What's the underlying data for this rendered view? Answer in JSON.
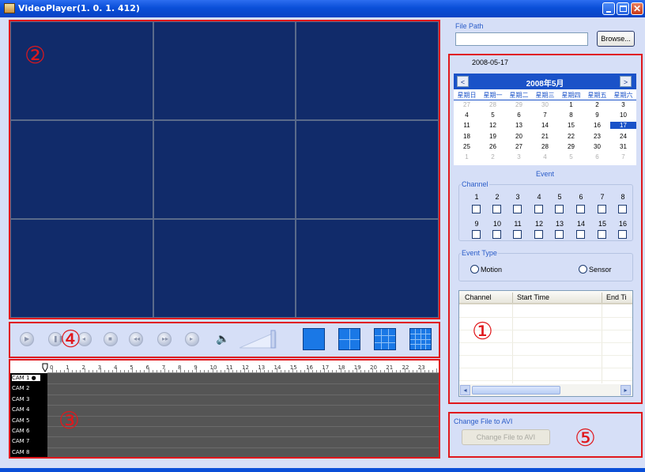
{
  "window": {
    "title": "VideoPlayer(1. 0. 1. 412)",
    "controls": {
      "minimize": "minimize-icon",
      "maximize": "maximize-icon",
      "close": "close-icon"
    }
  },
  "annotations": [
    "②",
    "④",
    "③",
    "①",
    "⑤"
  ],
  "file_path": {
    "label": "File Path",
    "value": "",
    "browse_label": "Browse..."
  },
  "date_label": "2008-05-17",
  "calendar": {
    "title": "2008年5月",
    "prev": "<",
    "next": ">",
    "weekdays": [
      "星期日",
      "星期一",
      "星期二",
      "星期三",
      "星期四",
      "星期五",
      "星期六"
    ],
    "weeks": [
      [
        "27",
        "28",
        "29",
        "30",
        "1",
        "2",
        "3"
      ],
      [
        "4",
        "5",
        "6",
        "7",
        "8",
        "9",
        "10"
      ],
      [
        "11",
        "12",
        "13",
        "14",
        "15",
        "16",
        "17"
      ],
      [
        "18",
        "19",
        "20",
        "21",
        "22",
        "23",
        "24"
      ],
      [
        "25",
        "26",
        "27",
        "28",
        "29",
        "30",
        "31"
      ],
      [
        "1",
        "2",
        "3",
        "4",
        "5",
        "6",
        "7"
      ]
    ],
    "selected_day": "17"
  },
  "event": {
    "title": "Event",
    "channel_label": "Channel",
    "channels_row1": [
      "1",
      "2",
      "3",
      "4",
      "5",
      "6",
      "7",
      "8"
    ],
    "channels_row2": [
      "9",
      "10",
      "11",
      "12",
      "13",
      "14",
      "15",
      "16"
    ],
    "type_label": "Event Type",
    "types": [
      "Motion",
      "Sensor"
    ]
  },
  "event_list": {
    "columns": [
      "Channel",
      "Start Time",
      "End Ti"
    ],
    "rows": []
  },
  "timeline": {
    "hours": [
      "0",
      "1",
      "2",
      "3",
      "4",
      "5",
      "6",
      "7",
      "8",
      "9",
      "10",
      "11",
      "12",
      "13",
      "14",
      "15",
      "16",
      "17",
      "18",
      "19",
      "20",
      "21",
      "22",
      "23"
    ],
    "cameras": [
      "CAM 1",
      "CAM 2",
      "CAM 3",
      "CAM 4",
      "CAM 5",
      "CAM 6",
      "CAM 7",
      "CAM 8"
    ],
    "selected_camera": "CAM 1"
  },
  "playback_icons": [
    "play-icon",
    "pause-icon",
    "frame-back-icon",
    "stop-icon",
    "rewind-icon",
    "fast-forward-icon",
    "frame-forward-icon"
  ],
  "layout_icons": [
    "layout-1-icon",
    "layout-4-icon",
    "layout-9-icon",
    "layout-16-icon"
  ],
  "avi": {
    "label": "Change File to AVI",
    "button": "Change File to AVI"
  },
  "colors": {
    "titlebar": "#0a4fd8",
    "video_bg": "#112b6a",
    "annotation": "#e0181c",
    "accent": "#1a52c8",
    "panel": "#d6dff7"
  }
}
